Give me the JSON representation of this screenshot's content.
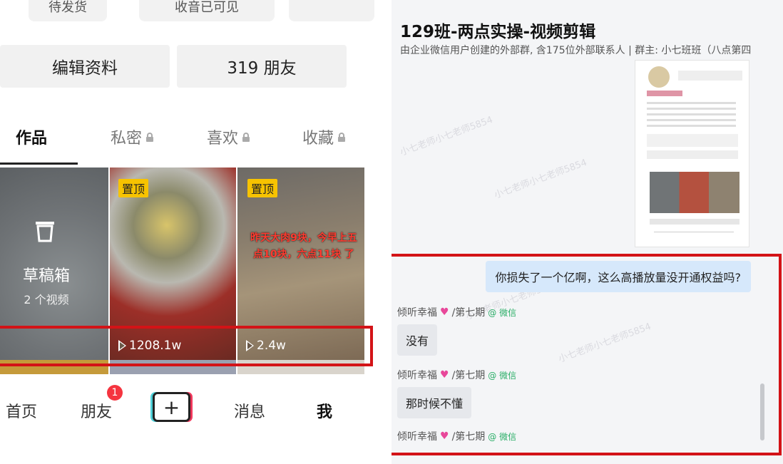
{
  "left": {
    "top_row": [
      "待发货",
      "收音已可见"
    ],
    "edit_profile": "编辑资料",
    "friends_count": "319 朋友",
    "tabs": [
      "作品",
      "私密",
      "喜欢",
      "收藏"
    ],
    "drafts": {
      "title": "草稿箱",
      "count": "2 个视频"
    },
    "pinned_label": "置顶",
    "video2": {
      "views": "1208.1w"
    },
    "video3": {
      "overlay": "昨天大肉9块，今早上五点10块，六点11块 了",
      "views": "2.4w"
    },
    "nav": {
      "home": "首页",
      "friends": "朋友",
      "friends_badge": "1",
      "plus": "+",
      "messages": "消息",
      "me": "我"
    }
  },
  "right": {
    "title": "129班-两点实操-视频剪辑",
    "subtitle": "由企业微信用户创建的外部群, 含175位外部联系人 | 群主: 小七班班（八点第四",
    "my_message": "你损失了一个亿啊，这么高播放量没开通权益吗?",
    "sender_name": "倾听幸福",
    "sender_group": "/第七期",
    "sender_source": "@ 微信",
    "replies": [
      "没有",
      "那时候不懂"
    ],
    "watermark": "小七老师小七老师5854"
  },
  "colors": {
    "highlight_red": "#d31317",
    "pinned_yellow": "#f7c300",
    "my_bubble": "#d6e8fb"
  }
}
